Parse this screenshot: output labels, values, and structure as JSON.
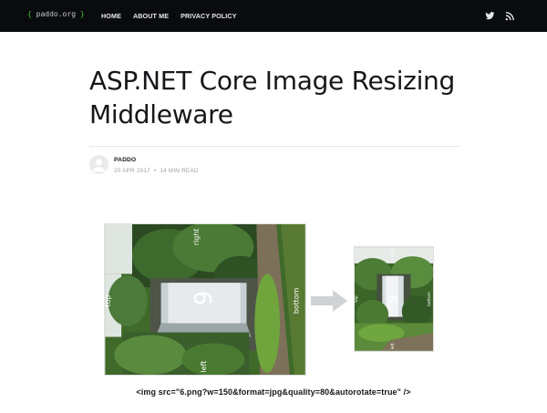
{
  "nav": {
    "logo": {
      "open": "{",
      "text": "paddo.org",
      "close": "}"
    },
    "links": [
      "HOME",
      "ABOUT ME",
      "PRIVACY POLICY"
    ],
    "icons": [
      "twitter-icon",
      "rss-icon"
    ]
  },
  "post": {
    "title": "ASP.NET Core Image Resizing Middleware",
    "author": "PADDO",
    "date": "20 APR 2017",
    "separator": "•",
    "read_time": "14 MIN READ"
  },
  "figure": {
    "big_labels": {
      "number": "6",
      "top": "top",
      "right": "right",
      "bottom": "bottom",
      "left": "left"
    },
    "small_labels": {
      "number": "6",
      "top": "top",
      "right": "right",
      "bottom": "bottom",
      "left": "left"
    },
    "caption": "<img src=\"6.png?w=150&format=jpg&quality=80&autorotate=true\" />"
  },
  "colors": {
    "nav_bg": "#0a0b0c",
    "logo_brace": "#3ec73e",
    "arrow": "#cfd3d6"
  }
}
